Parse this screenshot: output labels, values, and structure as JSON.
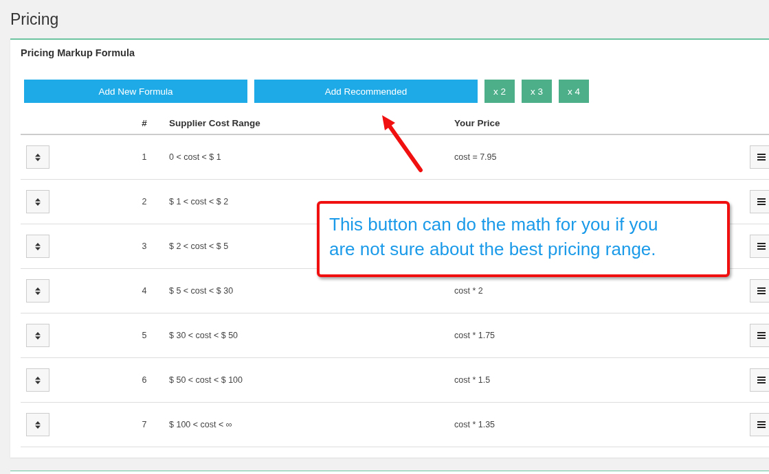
{
  "page": {
    "title": "Pricing"
  },
  "card": {
    "title": "Pricing Markup Formula"
  },
  "buttons": [
    {
      "label": "Add New Formula",
      "kind": "primary"
    },
    {
      "label": "Add Recommended",
      "kind": "primary"
    },
    {
      "label": "x 2",
      "kind": "multiplier"
    },
    {
      "label": "x 3",
      "kind": "multiplier"
    },
    {
      "label": "x 4",
      "kind": "multiplier"
    }
  ],
  "table": {
    "columns": [
      "#",
      "Supplier Cost Range",
      "Your Price"
    ],
    "rows": [
      {
        "number": "1",
        "range": "0 < cost < $ 1",
        "price": "cost = 7.95"
      },
      {
        "number": "2",
        "range": "$ 1 < cost < $ 2"
      },
      {
        "number": "3",
        "range": "$ 2 < cost < $ 5"
      },
      {
        "number": "4",
        "range": "$ 5 < cost < $ 30",
        "price": "cost * 2"
      },
      {
        "number": "5",
        "range": "$ 30 < cost < $ 50",
        "price": "cost * 1.75"
      },
      {
        "number": "6",
        "range": "$ 50 < cost < $ 100",
        "price": "cost * 1.5"
      },
      {
        "number": "7",
        "range": "$ 100 < cost < ∞",
        "price": "cost * 1.35"
      }
    ]
  },
  "callout": {
    "text": "This button can do the math for you if you are not sure about the best pricing range."
  }
}
